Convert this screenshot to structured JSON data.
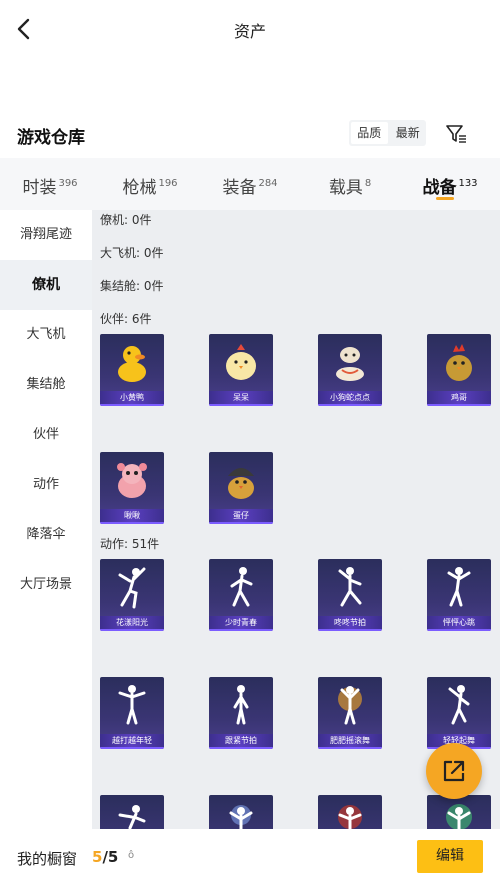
{
  "header": {
    "title": "资产"
  },
  "warehouse": {
    "title": "游戏仓库",
    "sort_options": [
      "品质",
      "最新"
    ]
  },
  "tabs": [
    {
      "label": "时装",
      "count": "396"
    },
    {
      "label": "枪械",
      "count": "196"
    },
    {
      "label": "装备",
      "count": "284"
    },
    {
      "label": "载具",
      "count": "8"
    },
    {
      "label": "战备",
      "count": "133"
    }
  ],
  "sidebar": [
    "滑翔尾迹",
    "僚机",
    "大飞机",
    "集结舱",
    "伙伴",
    "动作",
    "降落伞",
    "大厅场景"
  ],
  "sections": {
    "s0": "僚机: 0件",
    "s1": "大飞机: 0件",
    "s2": "集结舱: 0件",
    "s3": "伙伴: 6件",
    "s4": "动作: 51件"
  },
  "partners": [
    "小黄鸭",
    "呆呆",
    "小狗蛇点点",
    "鸡哥",
    "啾啾",
    "蛋仔"
  ],
  "actions_row1": [
    "花漾阳光",
    "少时青春",
    "咚咚节拍",
    "怦怦心跳"
  ],
  "actions_row2": [
    "越打越年轻",
    "跟紧节拍",
    "肥肥摇滚舞",
    "轻轻起舞"
  ],
  "bottom": {
    "label": "我的橱窗",
    "current": "5",
    "total": "/5",
    "lock_icon": "ô",
    "edit": "编辑"
  },
  "colors": {
    "accent": "#f5a623",
    "card_bg": "#2b2e5c",
    "button": "#fdbf14"
  }
}
